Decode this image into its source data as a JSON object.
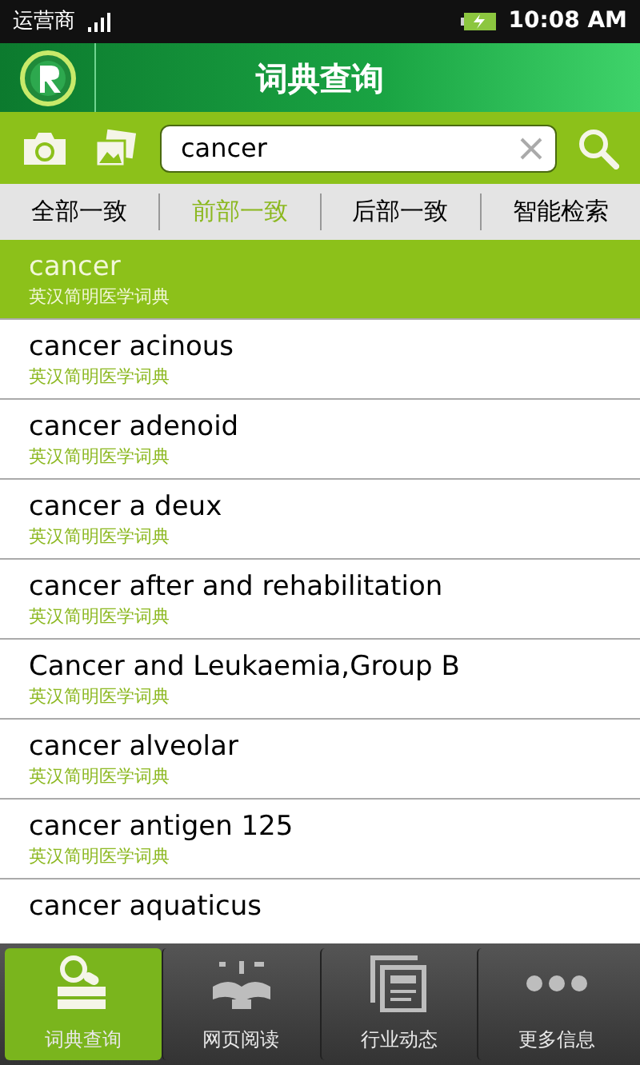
{
  "status_bar": {
    "carrier": "运营商",
    "time": "10:08 AM"
  },
  "header": {
    "title": "词典查询"
  },
  "search": {
    "value": "cancer"
  },
  "match_tabs": [
    {
      "label": "全部一致",
      "selected": false
    },
    {
      "label": "前部一致",
      "selected": true
    },
    {
      "label": "后部一致",
      "selected": false
    },
    {
      "label": "智能检索",
      "selected": false
    }
  ],
  "results": [
    {
      "term": "cancer",
      "source": "英汉简明医学词典",
      "selected": true
    },
    {
      "term": "cancer acinous",
      "source": "英汉简明医学词典",
      "selected": false
    },
    {
      "term": "cancer adenoid",
      "source": "英汉简明医学词典",
      "selected": false
    },
    {
      "term": "cancer a deux",
      "source": "英汉简明医学词典",
      "selected": false
    },
    {
      "term": "cancer after and rehabilitation",
      "source": "英汉简明医学词典",
      "selected": false
    },
    {
      "term": "Cancer and Leukaemia,Group B",
      "source": "英汉简明医学词典",
      "selected": false
    },
    {
      "term": "cancer alveolar",
      "source": "英汉简明医学词典",
      "selected": false
    },
    {
      "term": "cancer antigen 125",
      "source": "英汉简明医学词典",
      "selected": false
    },
    {
      "term": "cancer aquaticus",
      "selected": false
    }
  ],
  "bottom_nav": [
    {
      "label": "词典查询",
      "kind": "search",
      "selected": true
    },
    {
      "label": "网页阅读",
      "kind": "book",
      "selected": false
    },
    {
      "label": "行业动态",
      "kind": "news",
      "selected": false
    },
    {
      "label": "更多信息",
      "kind": "more",
      "selected": false
    }
  ]
}
